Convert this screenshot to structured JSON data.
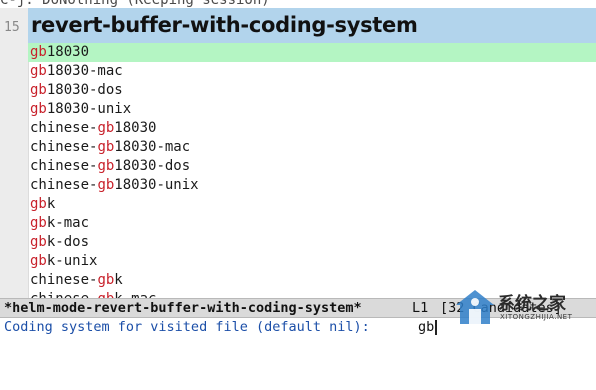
{
  "top_message": "C-j: DoNothing (Keeping session)",
  "gutter": {
    "line_number": "15"
  },
  "header": {
    "title": "revert-buffer-with-coding-system"
  },
  "candidates": [
    {
      "pre": "",
      "match": "gb",
      "post": "18030",
      "selected": true
    },
    {
      "pre": "",
      "match": "gb",
      "post": "18030-mac"
    },
    {
      "pre": "",
      "match": "gb",
      "post": "18030-dos"
    },
    {
      "pre": "",
      "match": "gb",
      "post": "18030-unix"
    },
    {
      "pre": "chinese-",
      "match": "gb",
      "post": "18030"
    },
    {
      "pre": "chinese-",
      "match": "gb",
      "post": "18030-mac"
    },
    {
      "pre": "chinese-",
      "match": "gb",
      "post": "18030-dos"
    },
    {
      "pre": "chinese-",
      "match": "gb",
      "post": "18030-unix"
    },
    {
      "pre": "",
      "match": "gb",
      "post": "k"
    },
    {
      "pre": "",
      "match": "gb",
      "post": "k-mac"
    },
    {
      "pre": "",
      "match": "gb",
      "post": "k-dos"
    },
    {
      "pre": "",
      "match": "gb",
      "post": "k-unix"
    },
    {
      "pre": "chinese-",
      "match": "gb",
      "post": "k"
    },
    {
      "pre": "chinese-",
      "match": "gb",
      "post": "k-mac"
    }
  ],
  "modeline": {
    "buffer_name": "*helm-mode-revert-buffer-with-coding-system*",
    "line": "L1",
    "candidates": "[32 Candidates]"
  },
  "minibuffer": {
    "prompt": "Coding system for visited file (default nil): ",
    "input": "gb"
  },
  "watermark": {
    "chinese": "系统之家",
    "english": "XITONGZHIJIA.NET"
  },
  "colors": {
    "header_bg": "#b2d4ec",
    "selected_bg": "#b4f5c3",
    "match": "#c8202a",
    "prompt": "#1c4fa8"
  }
}
